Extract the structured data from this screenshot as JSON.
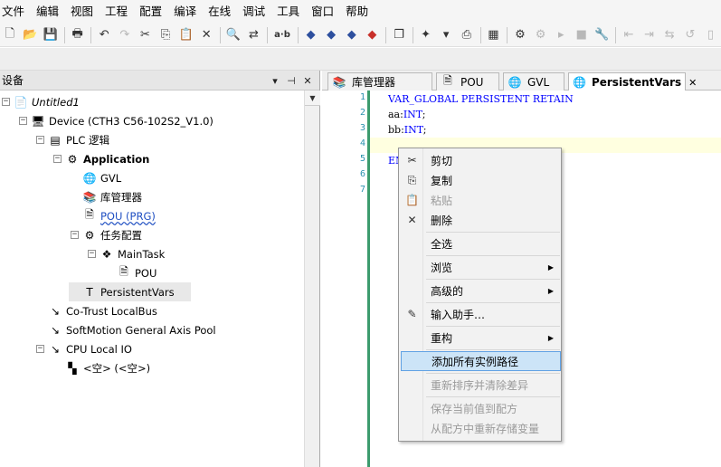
{
  "menubar": [
    "文件",
    "编辑",
    "视图",
    "工程",
    "配置",
    "编译",
    "在线",
    "调试",
    "工具",
    "窗口",
    "帮助"
  ],
  "toolbar": {
    "buttons": [
      {
        "name": "new-file-icon",
        "glyph": "🗋",
        "disabled": false
      },
      {
        "name": "open-folder-icon",
        "glyph": "📂",
        "disabled": false
      },
      {
        "name": "save-icon",
        "glyph": "💾",
        "disabled": false
      },
      {
        "name": "sep"
      },
      {
        "name": "print-icon",
        "glyph": "🖶",
        "disabled": false
      },
      {
        "name": "sep"
      },
      {
        "name": "undo-icon",
        "glyph": "↶",
        "disabled": false
      },
      {
        "name": "redo-icon",
        "glyph": "↷",
        "disabled": true
      },
      {
        "name": "cut-icon",
        "glyph": "✂",
        "disabled": false
      },
      {
        "name": "copy-icon",
        "glyph": "⎘",
        "disabled": false
      },
      {
        "name": "paste-icon",
        "glyph": "📋",
        "disabled": false
      },
      {
        "name": "delete-icon",
        "glyph": "✕",
        "disabled": false
      },
      {
        "name": "sep"
      },
      {
        "name": "find-icon",
        "glyph": "🔍",
        "disabled": false
      },
      {
        "name": "replace-icon",
        "glyph": "⇄",
        "disabled": false
      },
      {
        "name": "sep"
      },
      {
        "name": "ab-icon",
        "glyph": "a·b",
        "disabled": false,
        "text": true
      },
      {
        "name": "sep"
      },
      {
        "name": "breakpoint-icon",
        "glyph": "◆",
        "disabled": false,
        "color": "blue"
      },
      {
        "name": "step-over-icon",
        "glyph": "◆",
        "disabled": false,
        "color": "blue"
      },
      {
        "name": "step-into-icon",
        "glyph": "◆",
        "disabled": false,
        "color": "blue"
      },
      {
        "name": "step-out-icon",
        "glyph": "◆",
        "disabled": false,
        "color": "red"
      },
      {
        "name": "sep"
      },
      {
        "name": "windows-icon",
        "glyph": "❐",
        "disabled": false
      },
      {
        "name": "sep"
      },
      {
        "name": "add-object-icon",
        "glyph": "✦",
        "disabled": false
      },
      {
        "name": "dropdown-arrow-icon",
        "glyph": "▾",
        "disabled": false
      },
      {
        "name": "properties-icon",
        "glyph": "⎙",
        "disabled": false
      },
      {
        "name": "sep"
      },
      {
        "name": "build-icon",
        "glyph": "▦",
        "disabled": false
      },
      {
        "name": "sep"
      },
      {
        "name": "login-icon",
        "glyph": "⚙",
        "disabled": false
      },
      {
        "name": "logout-icon",
        "glyph": "⚙",
        "disabled": true
      },
      {
        "name": "run-icon",
        "glyph": "▸",
        "disabled": true
      },
      {
        "name": "stop-icon",
        "glyph": "■",
        "disabled": true
      },
      {
        "name": "tools-icon",
        "glyph": "🔧",
        "disabled": false
      },
      {
        "name": "sep"
      },
      {
        "name": "step-a-icon",
        "glyph": "⇤",
        "disabled": true
      },
      {
        "name": "step-b-icon",
        "glyph": "⇥",
        "disabled": true
      },
      {
        "name": "step-c-icon",
        "glyph": "⇆",
        "disabled": true
      },
      {
        "name": "step-d-icon",
        "glyph": "↺",
        "disabled": true
      },
      {
        "name": "step-e-icon",
        "glyph": "▯",
        "disabled": true
      }
    ]
  },
  "left_panel": {
    "title": "设备",
    "dropdown_icon": "▾",
    "pin_icon": "⊣",
    "close_icon": "✕"
  },
  "tree": [
    {
      "id": "untitled",
      "label": "Untitled1",
      "depth": 0,
      "toggle": "−",
      "icon": "📄",
      "style": "italic"
    },
    {
      "id": "device",
      "label": "Device (CTH3 C56-102S2_V1.0)",
      "depth": 1,
      "toggle": "−",
      "icon": "🖥"
    },
    {
      "id": "plc",
      "label": "PLC 逻辑",
      "depth": 2,
      "toggle": "−",
      "icon": "▤"
    },
    {
      "id": "application",
      "label": "Application",
      "depth": 3,
      "toggle": "−",
      "icon": "⚙",
      "style": "bold"
    },
    {
      "id": "gvl",
      "label": "GVL",
      "depth": 4,
      "toggle": "",
      "icon": "🌐"
    },
    {
      "id": "library",
      "label": "库管理器",
      "depth": 4,
      "toggle": "",
      "icon": "📚"
    },
    {
      "id": "pou",
      "label": "POU (PRG)",
      "depth": 4,
      "toggle": "",
      "icon": "🗎",
      "style": "link"
    },
    {
      "id": "task-config",
      "label": "任务配置",
      "depth": 4,
      "toggle": "−",
      "icon": "⚙"
    },
    {
      "id": "maintask",
      "label": "MainTask",
      "depth": 5,
      "toggle": "−",
      "icon": "❖"
    },
    {
      "id": "pou-call",
      "label": "POU",
      "depth": 6,
      "toggle": "",
      "icon": "🗎"
    },
    {
      "id": "persistent",
      "label": "PersistentVars",
      "depth": 4,
      "toggle": "",
      "icon": "T",
      "selected": true
    },
    {
      "id": "cotrust",
      "label": "Co-Trust LocalBus",
      "depth": 2,
      "toggle": "",
      "icon": "↘"
    },
    {
      "id": "softmotion",
      "label": "SoftMotion General Axis Pool",
      "depth": 2,
      "toggle": "",
      "icon": "↘"
    },
    {
      "id": "cpu-io",
      "label": "CPU Local IO",
      "depth": 2,
      "toggle": "−",
      "icon": "↘"
    },
    {
      "id": "empty",
      "label": "<空> (<空>)",
      "depth": 3,
      "toggle": "",
      "icon": "▚"
    }
  ],
  "tabs": [
    {
      "label": "库管理器",
      "icon": "📚",
      "active": false
    },
    {
      "label": "POU",
      "icon": "🗎",
      "active": false
    },
    {
      "label": "GVL",
      "icon": "🌐",
      "active": false
    },
    {
      "label": "PersistentVars",
      "icon": "🌐",
      "active": true,
      "close": "✕"
    }
  ],
  "editor": {
    "line_numbers": [
      "1",
      "2",
      "3",
      "4",
      "5",
      "6",
      "7"
    ],
    "lines": [
      {
        "text": "VAR_GLOBAL PERSISTENT RETAIN",
        "kind": "keyword"
      },
      {
        "text": "aa:",
        "type": "INT",
        "tail": ";"
      },
      {
        "text": "bb:",
        "type": "INT",
        "tail": ";"
      },
      {
        "text": "",
        "kind": "plain"
      },
      {
        "text": "END_VAR",
        "kind": "keyword"
      }
    ]
  },
  "context_menu": [
    {
      "label": "剪切",
      "icon": "✂",
      "disabled": false
    },
    {
      "label": "复制",
      "icon": "⎘",
      "disabled": false
    },
    {
      "label": "粘贴",
      "icon": "📋",
      "disabled": true
    },
    {
      "label": "删除",
      "icon": "✕",
      "disabled": false
    },
    {
      "sep": true
    },
    {
      "label": "全选",
      "icon": "",
      "disabled": false
    },
    {
      "sep": true
    },
    {
      "label": "浏览",
      "icon": "",
      "disabled": false,
      "submenu": true
    },
    {
      "sep": true
    },
    {
      "label": "高级的",
      "icon": "",
      "disabled": false,
      "submenu": true
    },
    {
      "sep": true
    },
    {
      "label": "输入助手…",
      "icon": "✎",
      "disabled": false
    },
    {
      "sep": true
    },
    {
      "label": "重构",
      "icon": "",
      "disabled": false,
      "submenu": true
    },
    {
      "sep": true
    },
    {
      "label": "添加所有实例路径",
      "icon": "",
      "disabled": false,
      "highlighted": true
    },
    {
      "sep": true
    },
    {
      "label": "重新排序并清除差异",
      "icon": "",
      "disabled": true
    },
    {
      "sep": true
    },
    {
      "label": "保存当前值到配方",
      "icon": "",
      "disabled": true
    },
    {
      "label": "从配方中重新存储变量",
      "icon": "",
      "disabled": true
    }
  ],
  "colors": {
    "keyword": "#0000ff",
    "line_number": "#2b91af",
    "gutter_bar": "#3c9b6e",
    "menu_highlight": "#cce4f7",
    "link": "#1f4fc2"
  }
}
